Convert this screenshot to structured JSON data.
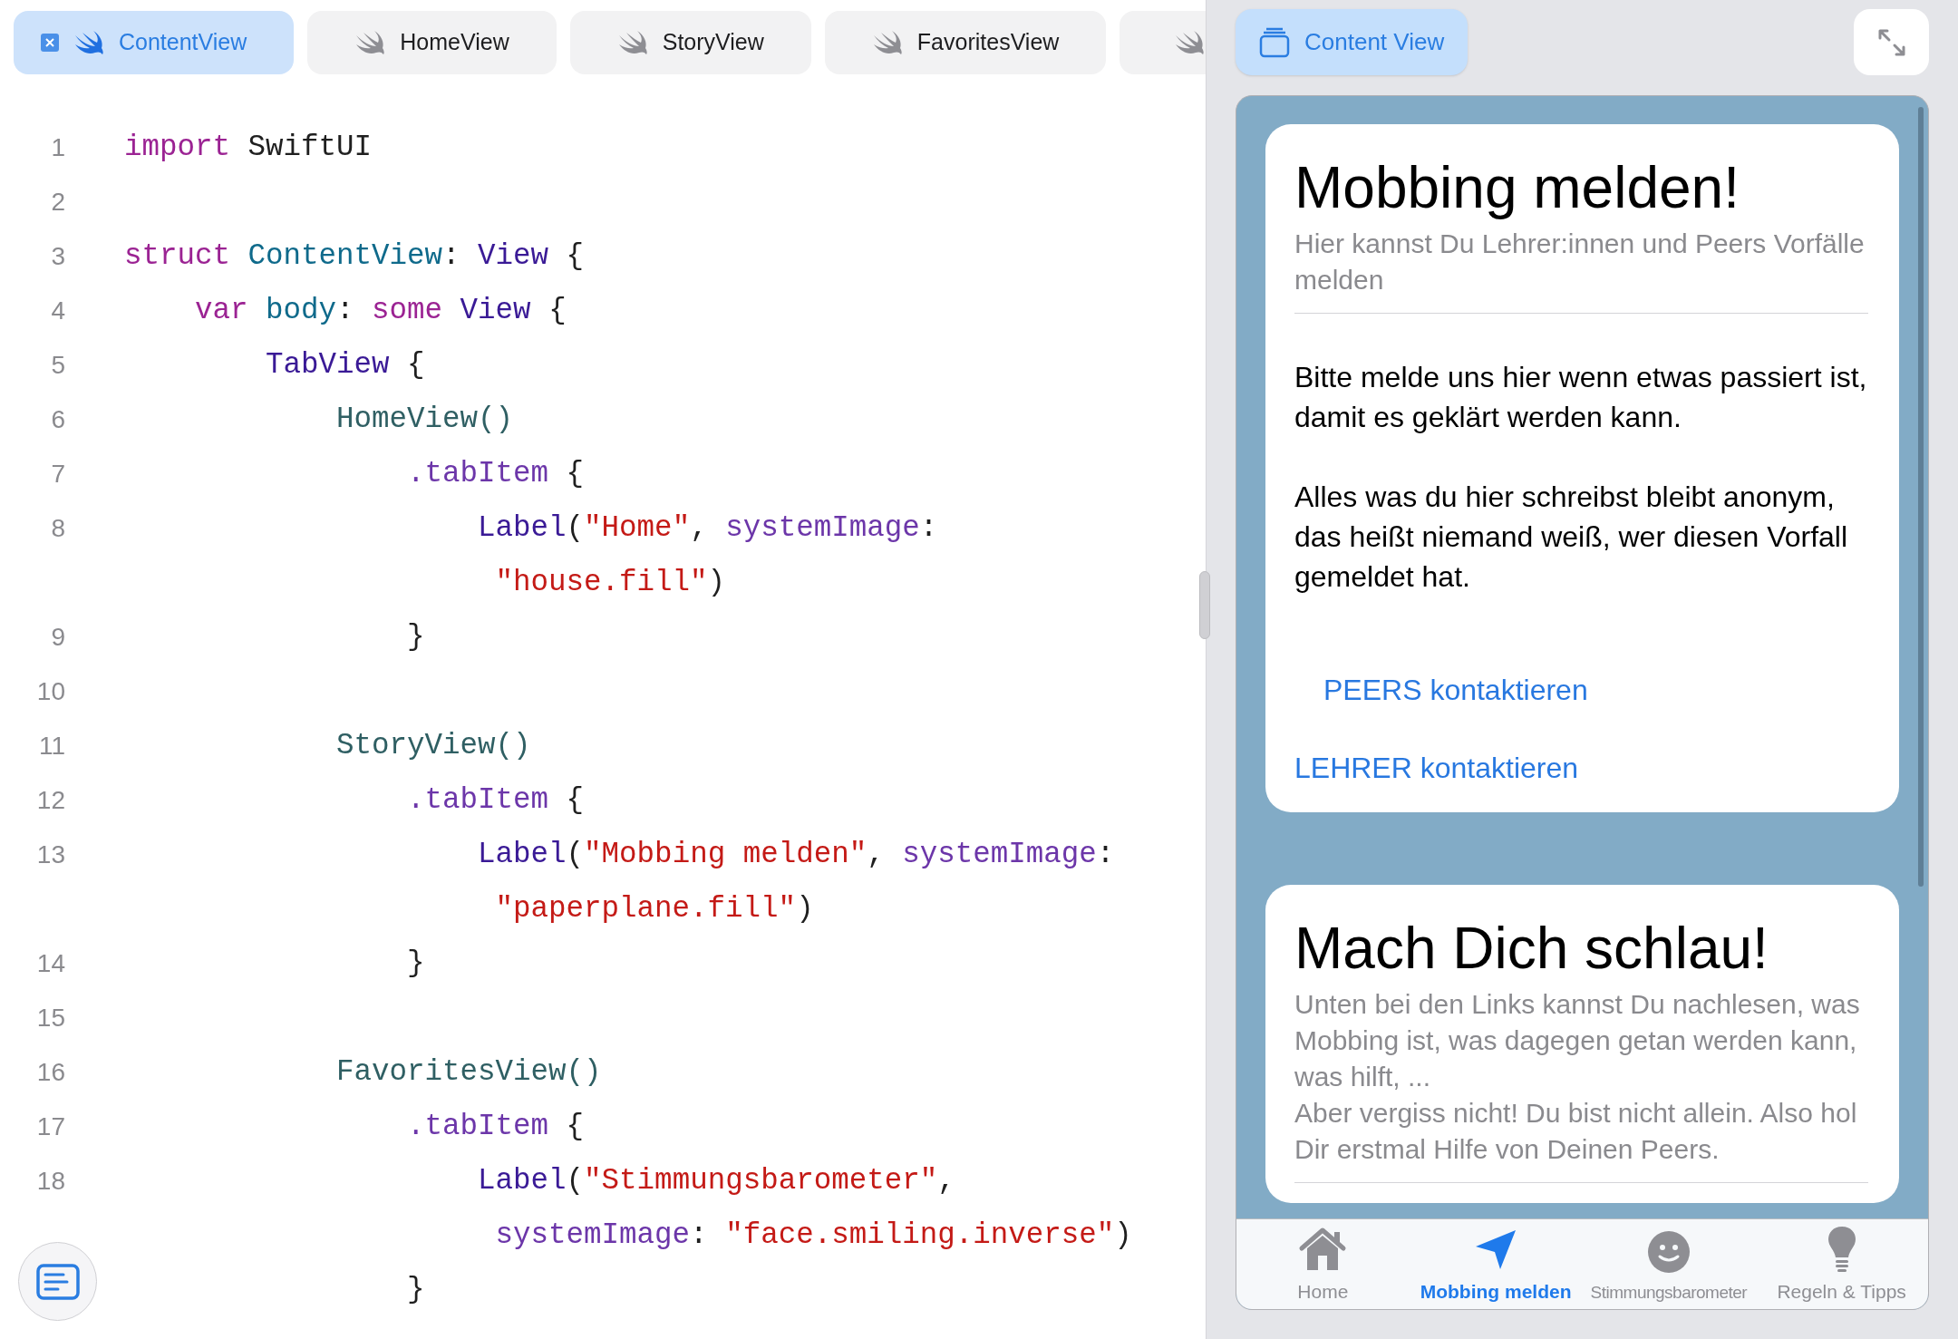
{
  "editor_tabs": [
    {
      "label": "ContentView",
      "selected": true
    },
    {
      "label": "HomeView",
      "selected": false
    },
    {
      "label": "StoryView",
      "selected": false
    },
    {
      "label": "FavoritesView",
      "selected": false
    },
    {
      "selected": false
    }
  ],
  "code_lines": [
    {
      "number": "1",
      "tokens": [
        {
          "kind": "keyword",
          "text": "import"
        },
        {
          "kind": "plain",
          "text": " SwiftUI"
        }
      ]
    },
    {
      "number": "2"
    },
    {
      "number": "3",
      "tokens": [
        {
          "kind": "keyword",
          "text": "struct"
        },
        {
          "kind": "decl",
          "text": " ContentView"
        },
        {
          "kind": "plain",
          "text": ": "
        },
        {
          "kind": "type",
          "text": "View"
        },
        {
          "kind": "plain",
          "text": " {"
        }
      ]
    },
    {
      "number": "4",
      "tokens": [
        {
          "kind": "keyword",
          "text": "    var"
        },
        {
          "kind": "decl",
          "text": " body"
        },
        {
          "kind": "plain",
          "text": ": "
        },
        {
          "kind": "keyword",
          "text": "some"
        },
        {
          "kind": "type",
          "text": " View"
        },
        {
          "kind": "plain",
          "text": " {"
        }
      ]
    },
    {
      "number": "5",
      "tokens": [
        {
          "kind": "type",
          "text": "        TabView"
        },
        {
          "kind": "plain",
          "text": " {"
        }
      ]
    },
    {
      "number": "6",
      "tokens": [
        {
          "kind": "call",
          "text": "            HomeView()"
        }
      ]
    },
    {
      "number": "7",
      "tokens": [
        {
          "kind": "member",
          "text": "                .tabItem"
        },
        {
          "kind": "plain",
          "text": " {"
        }
      ]
    },
    {
      "number": "8",
      "tokens": [
        {
          "kind": "type",
          "text": "                    Label"
        },
        {
          "kind": "plain",
          "text": "("
        },
        {
          "kind": "string",
          "text": "\"Home\""
        },
        {
          "kind": "plain",
          "text": ", "
        },
        {
          "kind": "member",
          "text": "systemImage"
        },
        {
          "kind": "plain",
          "text": ":"
        }
      ]
    },
    {
      "tokens": [
        {
          "kind": "string",
          "text": "                     \"house.fill\""
        },
        {
          "kind": "plain",
          "text": ")"
        }
      ]
    },
    {
      "number": "9",
      "tokens": [
        {
          "kind": "plain",
          "text": "                }"
        }
      ]
    },
    {
      "number": "10"
    },
    {
      "number": "11",
      "tokens": [
        {
          "kind": "call",
          "text": "            StoryView()"
        }
      ]
    },
    {
      "number": "12",
      "tokens": [
        {
          "kind": "member",
          "text": "                .tabItem"
        },
        {
          "kind": "plain",
          "text": " {"
        }
      ]
    },
    {
      "number": "13",
      "tokens": [
        {
          "kind": "type",
          "text": "                    Label"
        },
        {
          "kind": "plain",
          "text": "("
        },
        {
          "kind": "string",
          "text": "\"Mobbing melden\""
        },
        {
          "kind": "plain",
          "text": ", "
        },
        {
          "kind": "member",
          "text": "systemImage"
        },
        {
          "kind": "plain",
          "text": ":"
        }
      ]
    },
    {
      "tokens": [
        {
          "kind": "string",
          "text": "                     \"paperplane.fill\""
        },
        {
          "kind": "plain",
          "text": ")"
        }
      ]
    },
    {
      "number": "14",
      "tokens": [
        {
          "kind": "plain",
          "text": "                }"
        }
      ]
    },
    {
      "number": "15"
    },
    {
      "number": "16",
      "tokens": [
        {
          "kind": "call",
          "text": "            FavoritesView()"
        }
      ]
    },
    {
      "number": "17",
      "tokens": [
        {
          "kind": "member",
          "text": "                .tabItem"
        },
        {
          "kind": "plain",
          "text": " {"
        }
      ]
    },
    {
      "number": "18",
      "tokens": [
        {
          "kind": "type",
          "text": "                    Label"
        },
        {
          "kind": "plain",
          "text": "("
        },
        {
          "kind": "string",
          "text": "\"Stimmungsbarometer\""
        },
        {
          "kind": "plain",
          "text": ","
        }
      ]
    },
    {
      "tokens": [
        {
          "kind": "member",
          "text": "                     systemImage"
        },
        {
          "kind": "plain",
          "text": ": "
        },
        {
          "kind": "string",
          "text": "\"face.smiling.inverse\""
        },
        {
          "kind": "plain",
          "text": ")"
        }
      ]
    },
    {
      "tokens": [
        {
          "kind": "plain",
          "text": "                }"
        }
      ]
    }
  ],
  "preview": {
    "chip": "Content View",
    "cards": [
      {
        "title": "Mobbing melden!",
        "subtitle": [
          "Hier kannst Du Lehrer:innen und Peers Vorfälle melden"
        ],
        "paragraphs": [
          "Bitte melde uns hier wenn etwas passiert ist, damit es geklärt werden kann.",
          "Alles was du hier schreibst bleibt anonym, das heißt niemand weiß, wer diesen Vorfall gemeldet hat."
        ],
        "links": [
          {
            "label": "PEERS kontaktieren",
            "kind": "inset"
          },
          {
            "label": "LEHRER kontaktieren",
            "kind": "plain"
          }
        ]
      },
      {
        "title": "Mach Dich schlau!",
        "subtitle": [
          "Unten bei den Links kannst Du nachlesen, was Mobbing ist, was dagegen getan werden kann, was hilft, ...",
          "Aber vergiss nicht! Du bist nicht allein. Also hol Dir erstmal Hilfe von Deinen Peers."
        ]
      }
    ],
    "tab_bar": [
      {
        "label": "Home",
        "selected": false
      },
      {
        "label": "Mobbing melden",
        "selected": true
      },
      {
        "label": "Stimmungsbarometer",
        "selected": false
      },
      {
        "label": "Regeln & Tipps",
        "selected": false
      }
    ]
  }
}
